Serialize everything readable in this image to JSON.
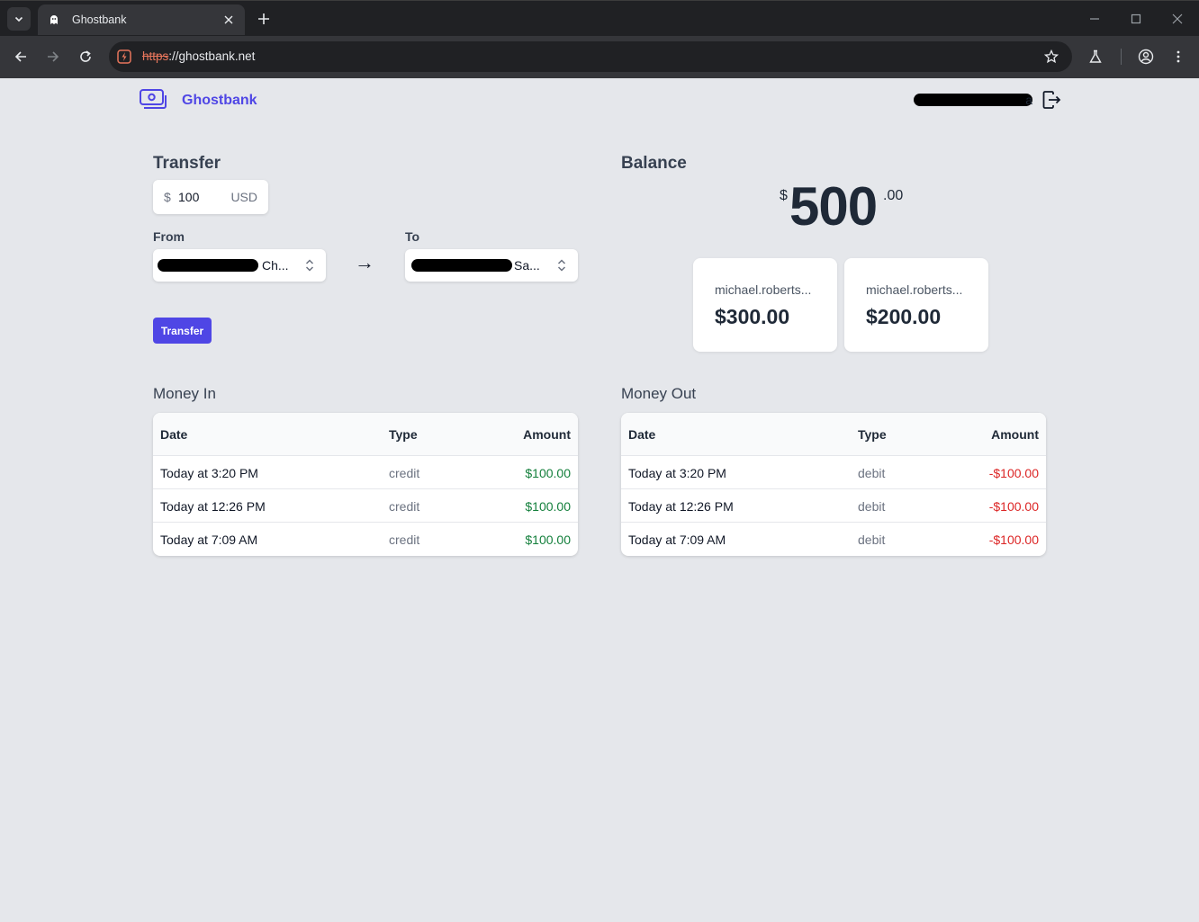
{
  "browser": {
    "tab_title": "Ghostbank",
    "url_scheme": "https",
    "url_rest": "://ghostbank.net"
  },
  "header": {
    "brand": "Ghostbank",
    "user_tail": "a"
  },
  "transfer": {
    "title": "Transfer",
    "currency_symbol": "$",
    "amount": "100",
    "currency_code": "USD",
    "from_label": "From",
    "from_value_tail": "Ch...",
    "to_label": "To",
    "to_value_tail": "Sa...",
    "arrow": "→",
    "button_label": "Transfer"
  },
  "balance": {
    "title": "Balance",
    "currency_symbol": "$",
    "whole": "500",
    "cents": ".00",
    "accounts": [
      {
        "name": "michael.roberts...",
        "amount": "$300.00"
      },
      {
        "name": "michael.roberts...",
        "amount": "$200.00"
      }
    ]
  },
  "money_in": {
    "title": "Money In",
    "columns": [
      "Date",
      "Type",
      "Amount"
    ],
    "rows": [
      {
        "date": "Today at 3:20 PM",
        "type": "credit",
        "amount": "$100.00"
      },
      {
        "date": "Today at 12:26 PM",
        "type": "credit",
        "amount": "$100.00"
      },
      {
        "date": "Today at 7:09 AM",
        "type": "credit",
        "amount": "$100.00"
      }
    ]
  },
  "money_out": {
    "title": "Money Out",
    "columns": [
      "Date",
      "Type",
      "Amount"
    ],
    "rows": [
      {
        "date": "Today at 3:20 PM",
        "type": "debit",
        "amount": "-$100.00"
      },
      {
        "date": "Today at 12:26 PM",
        "type": "debit",
        "amount": "-$100.00"
      },
      {
        "date": "Today at 7:09 AM",
        "type": "debit",
        "amount": "-$100.00"
      }
    ]
  },
  "colors": {
    "accent": "#4f46e5",
    "credit": "#15803d",
    "debit": "#dc2626",
    "page_bg": "#e5e7eb"
  }
}
